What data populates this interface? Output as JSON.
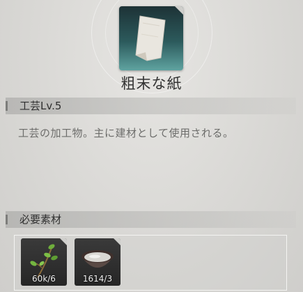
{
  "item": {
    "name": "粗末な紙",
    "icon": "paper-sheet-icon"
  },
  "craft_section": {
    "title": "工芸Lv.5"
  },
  "description": "工芸の加工物。主に建材として使用される。",
  "materials_section": {
    "title": "必要素材",
    "materials": [
      {
        "icon": "sprout-branch-icon",
        "count": "60k/6"
      },
      {
        "icon": "bowl-of-liquid-icon",
        "count": "1614/3"
      }
    ]
  },
  "colors": {
    "icon_bg_top": "#1d3236",
    "icon_bg_bottom": "#5fa3a0",
    "slot_bg": "#2b2b2b"
  }
}
